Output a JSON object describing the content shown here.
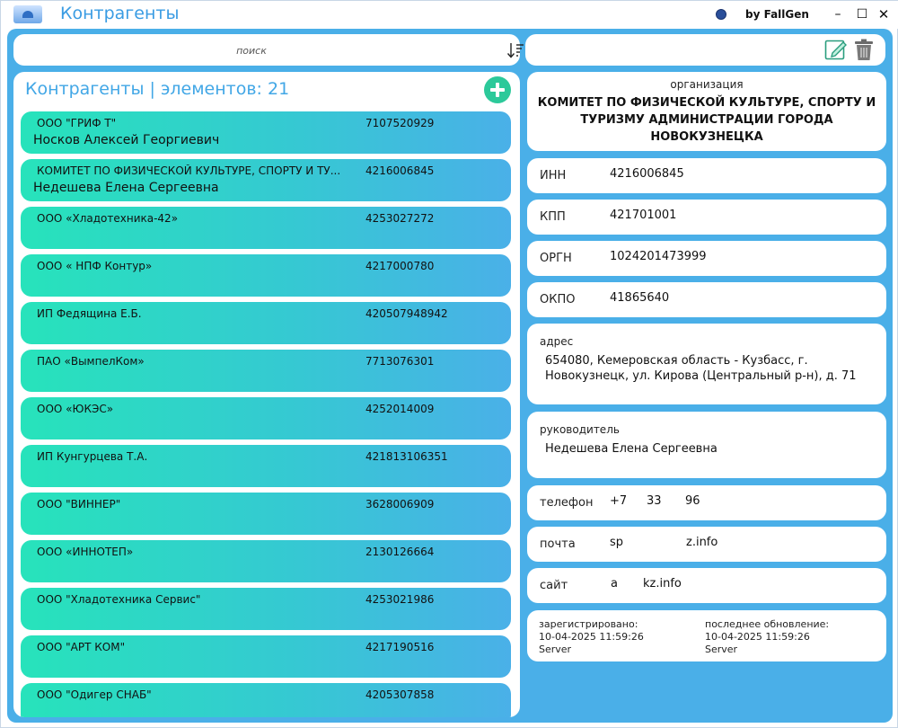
{
  "window": {
    "title": "Контрагенты",
    "byline": "by FallGen",
    "minimize_glyph": "–",
    "maximize_glyph": "☐",
    "close_glyph": "✕",
    "icons": [
      "app-logo-icon",
      "globe-icon",
      "sort-icon",
      "edit-icon",
      "trash-icon",
      "add-icon"
    ]
  },
  "search": {
    "placeholder": "поиск",
    "value": ""
  },
  "list": {
    "header": "Контрагенты | элементов: 21",
    "items": [
      {
        "name": "ООО \"ГРИФ Т\"",
        "inn": "7107520929",
        "person": "Носков Алексей Георгиевич"
      },
      {
        "name": "КОМИТЕТ ПО ФИЗИЧЕСКОЙ КУЛЬТУРЕ, СПОРТУ И ТУ...",
        "inn": "4216006845",
        "person": "Недешева Елена Сергеевна"
      },
      {
        "name": "ООО «Хладотехника-42»",
        "inn": "4253027272",
        "person": ""
      },
      {
        "name": "ООО « НПФ Контур»",
        "inn": "4217000780",
        "person": ""
      },
      {
        "name": "ИП Федящина Е.Б.",
        "inn": "420507948942",
        "person": ""
      },
      {
        "name": "ПАО «ВымпелКом»",
        "inn": "7713076301",
        "person": ""
      },
      {
        "name": "ООО «ЮКЭС»",
        "inn": "4252014009",
        "person": ""
      },
      {
        "name": "ИП Кунгурцева Т.А.",
        "inn": "421813106351",
        "person": ""
      },
      {
        "name": "ООО \"ВИННЕР\"",
        "inn": "3628006909",
        "person": ""
      },
      {
        "name": "ООО «ИННОТЕП»",
        "inn": "2130126664",
        "person": ""
      },
      {
        "name": "ООО \"Хладотехника Сервис\"",
        "inn": "4253021986",
        "person": ""
      },
      {
        "name": "ООО \"АРТ КОМ\"",
        "inn": "4217190516",
        "person": ""
      },
      {
        "name": "ООО \"Одигер СНАБ\"",
        "inn": "4205307858",
        "person": ""
      }
    ]
  },
  "details": {
    "org_label": "организация",
    "org_name": "КОМИТЕТ ПО ФИЗИЧЕСКОЙ КУЛЬТУРЕ, СПОРТУ И ТУРИЗМУ АДМИНИСТРАЦИИ ГОРОДА НОВОКУЗНЕЦКА",
    "inn_label": "ИНН",
    "inn": "4216006845",
    "kpp_label": "КПП",
    "kpp": "421701001",
    "ogrn_label": "ОРГН",
    "ogrn": "1024201473999",
    "okpo_label": "ОКПО",
    "okpo": "41865640",
    "address_label": "адрес",
    "address": "654080, Кемеровская область - Кузбасс, г. Новокузнецк, ул. Кирова (Центральный р-н), д. 71",
    "head_label": "руководитель",
    "head": "Недешева Елена Сергеевна",
    "phone_label": "телефон",
    "phone_parts": [
      "+7",
      "33",
      "96"
    ],
    "email_label": "почта",
    "email_parts": [
      "sp",
      "z.info"
    ],
    "site_label": "сайт",
    "site_parts": [
      "a",
      "kz.info"
    ],
    "registered_label": "зарегистрировано:",
    "registered_date": "10-04-2025 11:59:26",
    "registered_by": "Server",
    "updated_label": "последнее обновление:",
    "updated_date": "10-04-2025 11:59:26",
    "updated_by": "Server"
  },
  "colors": {
    "accent": "#4aafe8",
    "title_text": "#3a9ce3",
    "item_gradient_start": "#27e3bb",
    "item_gradient_end": "#4ab0e8",
    "add_button": "#2cc99a",
    "link": "#3a8fd9"
  }
}
